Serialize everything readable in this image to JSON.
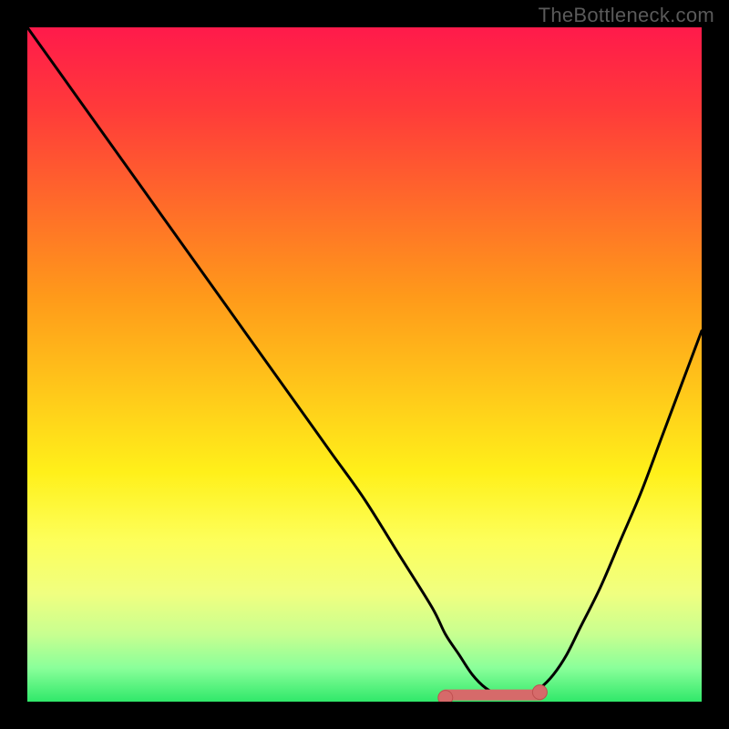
{
  "watermark": "TheBottleneck.com",
  "colors": {
    "background": "#000000",
    "curve": "#000000",
    "marker_fill": "#d66a6a",
    "marker_stroke": "#c05050",
    "watermark": "#5a5a5a",
    "gradient_stops": [
      "#ff1a4b",
      "#ff3a3a",
      "#ff6a2a",
      "#ff9a1a",
      "#ffc81a",
      "#fff01a",
      "#fdff5a",
      "#f0ff80",
      "#c8ff90",
      "#8aff9a",
      "#30e86a"
    ]
  },
  "chart_data": {
    "type": "line",
    "title": "",
    "xlabel": "",
    "ylabel": "",
    "xlim": [
      0,
      100
    ],
    "ylim": [
      0,
      100
    ],
    "x": [
      0,
      5,
      10,
      15,
      20,
      25,
      30,
      35,
      40,
      45,
      50,
      55,
      60,
      62,
      64,
      66,
      68,
      70,
      72,
      74,
      76,
      78,
      80,
      82,
      85,
      88,
      91,
      94,
      97,
      100
    ],
    "values": [
      100,
      93,
      86,
      79,
      72,
      65,
      58,
      51,
      44,
      37,
      30,
      22,
      14,
      10,
      7,
      4,
      2,
      1,
      1,
      1,
      2,
      4,
      7,
      11,
      17,
      24,
      31,
      39,
      47,
      55
    ],
    "highlight_segment": {
      "x_start": 62,
      "x_end": 76,
      "y_level": 1
    }
  }
}
